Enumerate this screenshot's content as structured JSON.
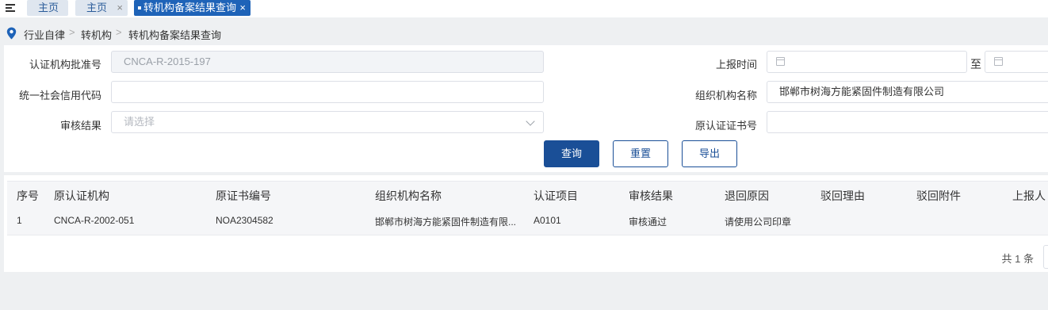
{
  "tabs": [
    {
      "label": "主页",
      "closable": false
    },
    {
      "label": "主页",
      "closable": true,
      "close": "×"
    },
    {
      "label": "转机构备案结果查询",
      "closable": true,
      "close": "×",
      "active": true
    }
  ],
  "breadcrumb": {
    "icon": "location-pin-icon",
    "items": [
      "行业自律",
      "转机构",
      "转机构备案结果查询"
    ],
    "separator": ">"
  },
  "form": {
    "approval_no_label": "认证机构批准号",
    "approval_no_value": "CNCA-R-2015-197",
    "credit_code_label": "统一社会信用代码",
    "credit_code_value": "",
    "review_result_label": "审核结果",
    "review_result_placeholder": "请选择",
    "report_time_label": "上报时间",
    "report_time_to": "至",
    "org_name_label": "组织机构名称",
    "org_name_value": "邯郸市树海方能紧固件制造有限公司",
    "orig_cert_no_label": "原认证证书号",
    "orig_cert_no_value": ""
  },
  "buttons": {
    "query": "查询",
    "reset": "重置",
    "export": "导出"
  },
  "table": {
    "columns": [
      "序号",
      "原认证机构",
      "原证书编号",
      "组织机构名称",
      "认证项目",
      "审核结果",
      "退回原因",
      "驳回理由",
      "驳回附件",
      "上报人"
    ],
    "rows": [
      [
        "1",
        "CNCA-R-2002-051",
        "NOA2304582",
        "邯郸市树海方能紧固件制造有限...",
        "A0101",
        "审核通过",
        "请使用公司印章",
        "",
        "",
        ""
      ]
    ]
  },
  "pagination": {
    "total_text": "共 1 条"
  },
  "colors": {
    "primary": "#1a4f97",
    "tab_active": "#1e63b8",
    "pin": "#1e63b8"
  }
}
